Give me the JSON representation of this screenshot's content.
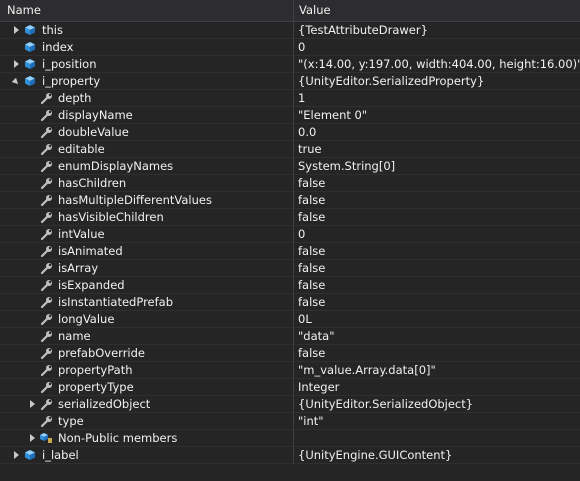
{
  "header": {
    "name": "Name",
    "value": "Value"
  },
  "rows": [
    {
      "depth": 0,
      "toggle": "collapsed",
      "icon": "object-icon",
      "name": "this",
      "value": "{TestAttributeDrawer}"
    },
    {
      "depth": 0,
      "toggle": "none",
      "icon": "object-icon",
      "name": "index",
      "value": "0"
    },
    {
      "depth": 0,
      "toggle": "collapsed",
      "icon": "object-icon",
      "name": "i_position",
      "value": "\"(x:14.00, y:197.00, width:404.00, height:16.00)\""
    },
    {
      "depth": 0,
      "toggle": "expanded",
      "icon": "object-icon",
      "name": "i_property",
      "value": "{UnityEditor.SerializedProperty}"
    },
    {
      "depth": 1,
      "toggle": "none",
      "icon": "wrench-icon",
      "name": "depth",
      "value": "1"
    },
    {
      "depth": 1,
      "toggle": "none",
      "icon": "wrench-icon",
      "name": "displayName",
      "value": "\"Element 0\""
    },
    {
      "depth": 1,
      "toggle": "none",
      "icon": "wrench-icon",
      "name": "doubleValue",
      "value": "0.0"
    },
    {
      "depth": 1,
      "toggle": "none",
      "icon": "wrench-icon",
      "name": "editable",
      "value": "true"
    },
    {
      "depth": 1,
      "toggle": "none",
      "icon": "wrench-icon",
      "name": "enumDisplayNames",
      "value": "System.String[0]"
    },
    {
      "depth": 1,
      "toggle": "none",
      "icon": "wrench-icon",
      "name": "hasChildren",
      "value": "false"
    },
    {
      "depth": 1,
      "toggle": "none",
      "icon": "wrench-icon",
      "name": "hasMultipleDifferentValues",
      "value": "false"
    },
    {
      "depth": 1,
      "toggle": "none",
      "icon": "wrench-icon",
      "name": "hasVisibleChildren",
      "value": "false"
    },
    {
      "depth": 1,
      "toggle": "none",
      "icon": "wrench-icon",
      "name": "intValue",
      "value": "0"
    },
    {
      "depth": 1,
      "toggle": "none",
      "icon": "wrench-icon",
      "name": "isAnimated",
      "value": "false"
    },
    {
      "depth": 1,
      "toggle": "none",
      "icon": "wrench-icon",
      "name": "isArray",
      "value": "false"
    },
    {
      "depth": 1,
      "toggle": "none",
      "icon": "wrench-icon",
      "name": "isExpanded",
      "value": "false"
    },
    {
      "depth": 1,
      "toggle": "none",
      "icon": "wrench-icon",
      "name": "isInstantiatedPrefab",
      "value": "false"
    },
    {
      "depth": 1,
      "toggle": "none",
      "icon": "wrench-icon",
      "name": "longValue",
      "value": "0L"
    },
    {
      "depth": 1,
      "toggle": "none",
      "icon": "wrench-icon",
      "name": "name",
      "value": "\"data\""
    },
    {
      "depth": 1,
      "toggle": "none",
      "icon": "wrench-icon",
      "name": "prefabOverride",
      "value": "false"
    },
    {
      "depth": 1,
      "toggle": "none",
      "icon": "wrench-icon",
      "name": "propertyPath",
      "value": "\"m_value.Array.data[0]\""
    },
    {
      "depth": 1,
      "toggle": "none",
      "icon": "wrench-icon",
      "name": "propertyType",
      "value": "Integer"
    },
    {
      "depth": 1,
      "toggle": "collapsed",
      "icon": "wrench-icon",
      "name": "serializedObject",
      "value": "{UnityEditor.SerializedObject}"
    },
    {
      "depth": 1,
      "toggle": "none",
      "icon": "wrench-icon",
      "name": "type",
      "value": "\"int\""
    },
    {
      "depth": 1,
      "toggle": "collapsed",
      "icon": "members-icon",
      "name": "Non-Public members",
      "value": ""
    },
    {
      "depth": 0,
      "toggle": "collapsed",
      "icon": "object-icon",
      "name": "i_label",
      "value": "{UnityEngine.GUIContent}"
    }
  ],
  "colors": {
    "background": "#252526",
    "header": "#2d2d30",
    "gridline": "#3f3f46",
    "object_icon": "#3f9fe0",
    "wrench_icon": "#c0c0c0",
    "text": "#f1f1f1"
  }
}
